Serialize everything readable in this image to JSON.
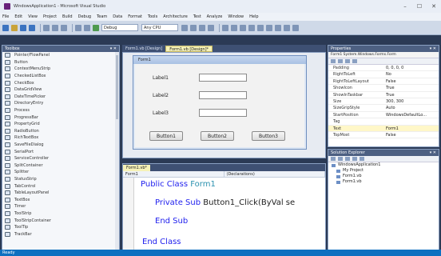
{
  "window": {
    "title": "WindowsApplication1 - Microsoft Visual Studio",
    "controls": [
      "–",
      "☐",
      "✕"
    ]
  },
  "menu": [
    "File",
    "Edit",
    "View",
    "Project",
    "Build",
    "Debug",
    "Team",
    "Data",
    "Format",
    "Tools",
    "Architecture",
    "Test",
    "Analyze",
    "Window",
    "Help"
  ],
  "toolbar": {
    "config_value": "Debug",
    "platform_value": "Any CPU"
  },
  "toolbox": {
    "title": "Toolbox",
    "items": [
      "Pointer/FlowPanel",
      "Button",
      "ContextMenuStrip",
      "CheckedListBox",
      "CheckBox",
      "DataGridView",
      "DateTimePicker",
      "DirectoryEntry",
      "Process",
      "ProgressBar",
      "PropertyGrid",
      "RadioButton",
      "RichTextBox",
      "SaveFileDialog",
      "SerialPort",
      "ServiceController",
      "SplitContainer",
      "Splitter",
      "StatusStrip",
      "TabControl",
      "TableLayoutPanel",
      "TextBox",
      "Timer",
      "ToolStrip",
      "ToolStripContainer",
      "ToolTip",
      "TrackBar"
    ]
  },
  "designer": {
    "tabs": [
      "Form1.vb [Design]",
      "Form1.vb [Design]*"
    ],
    "form_title": "Form1",
    "labels": [
      "Label1",
      "Label2",
      "Label3"
    ],
    "buttons": [
      "Button1",
      "Button2",
      "Button3"
    ]
  },
  "code": {
    "tab": "Form1.vb*",
    "object_combo": "Form1",
    "event_combo": "(Declarations)",
    "line1_kw": "Public Class",
    "line1_name": "Form1",
    "line2_kw": "Private Sub",
    "line2_rest": "Button1_Click(ByVal se",
    "line3": "End Sub",
    "line4": "End Class"
  },
  "properties": {
    "title": "Properties",
    "object": "Form1 System.Windows.Forms.Form",
    "rows": [
      [
        "Padding",
        "0, 0, 0, 0"
      ],
      [
        "RightToLeft",
        "No"
      ],
      [
        "RightToLeftLayout",
        "False"
      ],
      [
        "ShowIcon",
        "True"
      ],
      [
        "ShowInTaskbar",
        "True"
      ],
      [
        "Size",
        "300, 300"
      ],
      [
        "SizeGripStyle",
        "Auto"
      ],
      [
        "StartPosition",
        "WindowsDefaultLo..."
      ],
      [
        "Tag",
        ""
      ],
      [
        "Text",
        "Form1"
      ],
      [
        "TopMost",
        "False"
      ]
    ]
  },
  "solution": {
    "title": "Solution Explorer",
    "nodes": [
      "WindowsApplication1",
      "My Project",
      "Form1.vb",
      "Form1.vb"
    ]
  },
  "status": "Ready"
}
